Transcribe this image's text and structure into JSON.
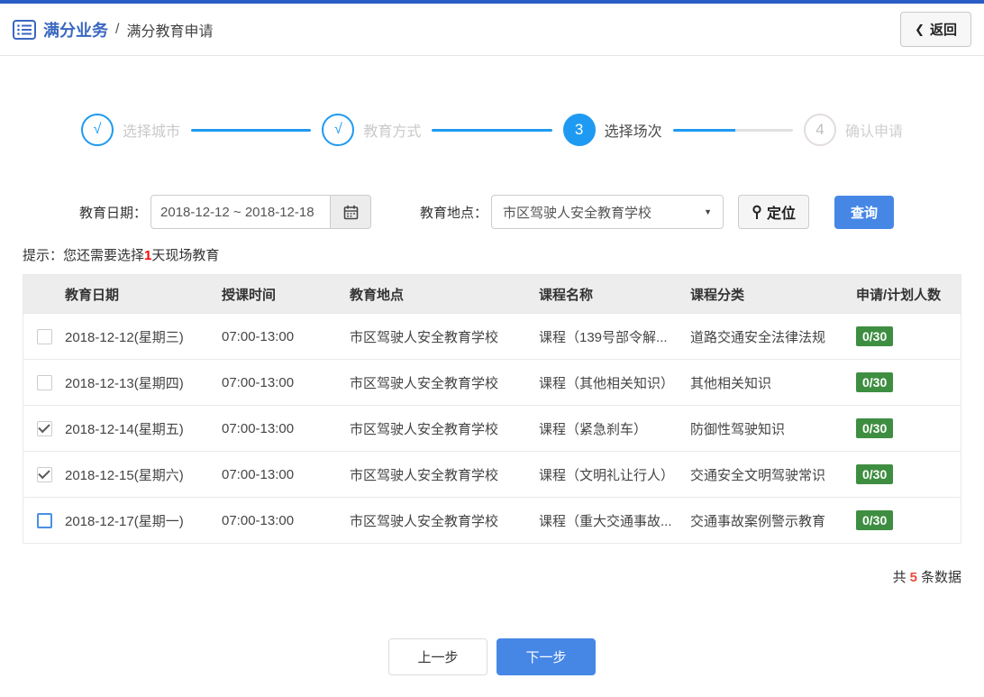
{
  "header": {
    "breadcrumb_primary": "满分业务",
    "breadcrumb_separator": "/",
    "breadcrumb_secondary": "满分教育申请",
    "back_chevron": "❮",
    "back_label": "返回"
  },
  "stepper": {
    "steps": [
      {
        "indicator": "√",
        "label": "选择城市",
        "state": "done"
      },
      {
        "indicator": "√",
        "label": "教育方式",
        "state": "done"
      },
      {
        "indicator": "3",
        "label": "选择场次",
        "state": "active"
      },
      {
        "indicator": "4",
        "label": "确认申请",
        "state": "pending"
      }
    ]
  },
  "filters": {
    "date_label": "教育日期：",
    "date_value": "2018-12-12 ~ 2018-12-18",
    "location_label": "教育地点：",
    "location_value": "市区驾驶人安全教育学校",
    "dropdown_caret": "▼",
    "locate_label": "定位",
    "search_label": "查询"
  },
  "tip": {
    "prefix": "提示：您还需要选择",
    "highlight": "1",
    "suffix": "天现场教育"
  },
  "table": {
    "headers": {
      "date": "教育日期",
      "time": "授课时间",
      "location": "教育地点",
      "course": "课程名称",
      "category": "课程分类",
      "quota": "申请/计划人数"
    },
    "rows": [
      {
        "state": "unchecked",
        "date": "2018-12-12(星期三)",
        "time": "07:00-13:00",
        "location": "市区驾驶人安全教育学校",
        "course": "课程（139号部令解...",
        "category": "道路交通安全法律法规",
        "quota": "0/30"
      },
      {
        "state": "unchecked",
        "date": "2018-12-13(星期四)",
        "time": "07:00-13:00",
        "location": "市区驾驶人安全教育学校",
        "course": "课程（其他相关知识）",
        "category": "其他相关知识",
        "quota": "0/30"
      },
      {
        "state": "checked",
        "date": "2018-12-14(星期五)",
        "time": "07:00-13:00",
        "location": "市区驾驶人安全教育学校",
        "course": "课程（紧急刹车）",
        "category": "防御性驾驶知识",
        "quota": "0/30"
      },
      {
        "state": "checked",
        "date": "2018-12-15(星期六)",
        "time": "07:00-13:00",
        "location": "市区驾驶人安全教育学校",
        "course": "课程（文明礼让行人）",
        "category": "交通安全文明驾驶常识",
        "quota": "0/30"
      },
      {
        "state": "focus",
        "date": "2018-12-17(星期一)",
        "time": "07:00-13:00",
        "location": "市区驾驶人安全教育学校",
        "course": "课程（重大交通事故...",
        "category": "交通事故案例警示教育",
        "quota": "0/30"
      }
    ]
  },
  "summary": {
    "prefix": "共",
    "count": "5",
    "suffix": "条数据"
  },
  "actions": {
    "prev_label": "上一步",
    "next_label": "下一步"
  },
  "colors": {
    "top_border_blue": "#2a5cc6",
    "brand_blue": "#3a67c0",
    "step_blue": "#1e9af2",
    "button_blue": "#4687e6",
    "badge_green": "#3e8e41",
    "alert_red": "#f00000",
    "count_red": "#e74c3c"
  }
}
